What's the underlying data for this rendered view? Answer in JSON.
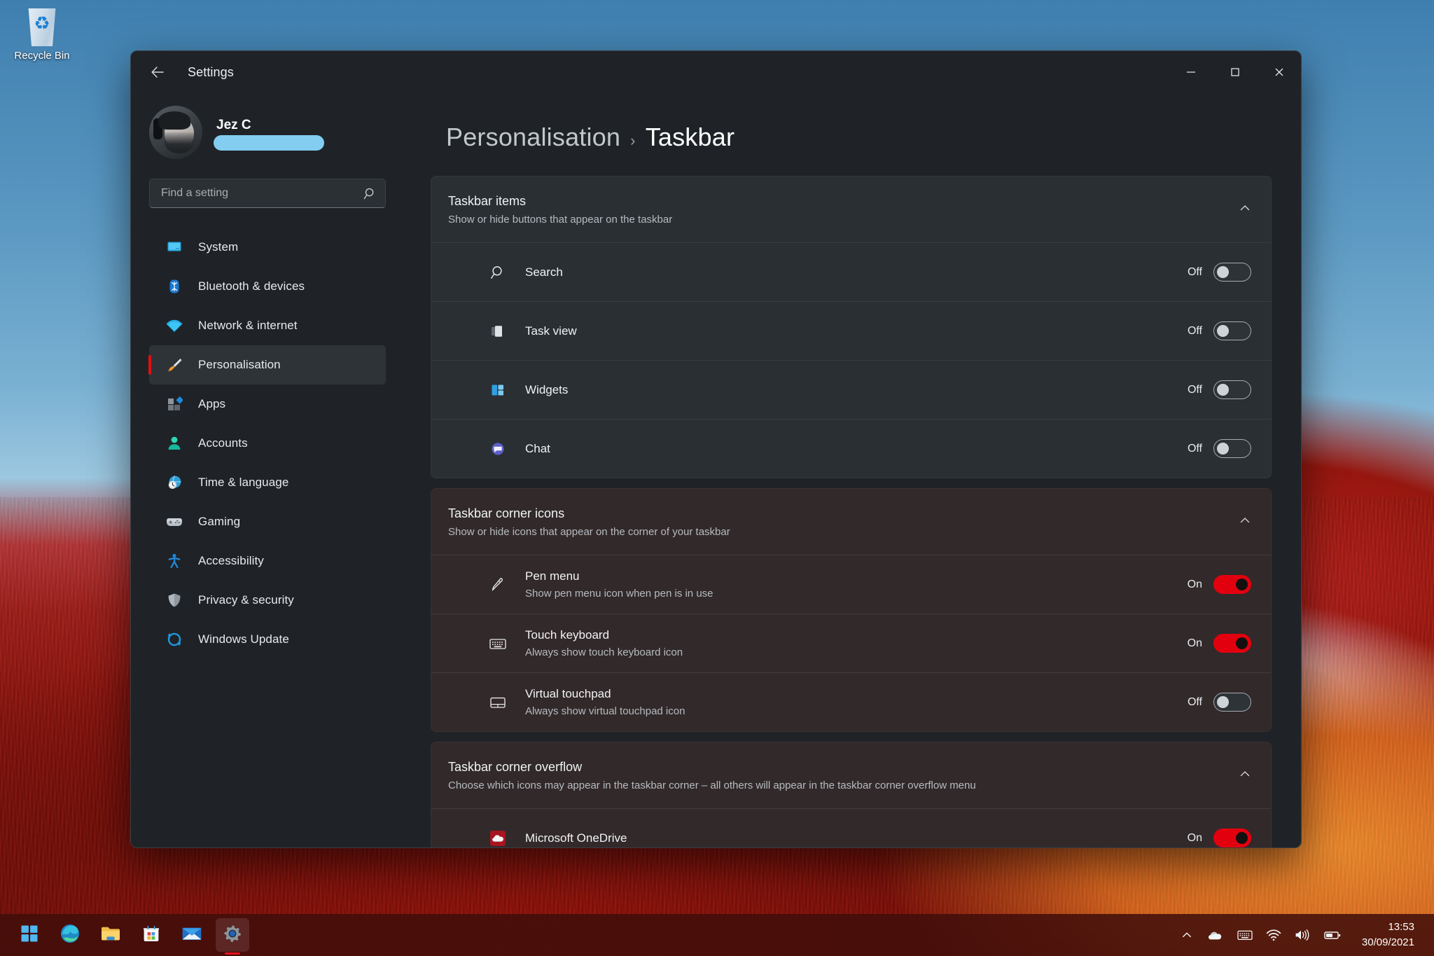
{
  "desktop": {
    "recycle_bin_label": "Recycle Bin",
    "recycle_bin_icon": "recycle-bin-icon"
  },
  "window": {
    "title": "Settings",
    "back_icon": "back-arrow-icon",
    "controls": {
      "minimize": "minimize-icon",
      "maximize": "maximize-icon",
      "close": "close-icon"
    }
  },
  "sidebar": {
    "account": {
      "name": "Jez C",
      "email": "redacted",
      "avatar_icon": "user-avatar"
    },
    "search": {
      "placeholder": "Find a setting",
      "value": "",
      "icon": "search-icon"
    },
    "items": [
      {
        "label": "System",
        "icon": "monitor-icon",
        "selected": false
      },
      {
        "label": "Bluetooth & devices",
        "icon": "bluetooth-icon",
        "selected": false
      },
      {
        "label": "Network & internet",
        "icon": "wifi-icon",
        "selected": false
      },
      {
        "label": "Personalisation",
        "icon": "paintbrush-icon",
        "selected": true
      },
      {
        "label": "Apps",
        "icon": "apps-grid-icon",
        "selected": false
      },
      {
        "label": "Accounts",
        "icon": "person-icon",
        "selected": false
      },
      {
        "label": "Time & language",
        "icon": "clock-globe-icon",
        "selected": false
      },
      {
        "label": "Gaming",
        "icon": "gamepad-icon",
        "selected": false
      },
      {
        "label": "Accessibility",
        "icon": "accessibility-icon",
        "selected": false
      },
      {
        "label": "Privacy & security",
        "icon": "shield-icon",
        "selected": false
      },
      {
        "label": "Windows Update",
        "icon": "update-refresh-icon",
        "selected": false
      }
    ]
  },
  "main": {
    "breadcrumb": {
      "parent": "Personalisation",
      "separator": "›",
      "current": "Taskbar"
    },
    "cards": [
      {
        "title": "Taskbar items",
        "subtitle": "Show or hide buttons that appear on the taskbar",
        "collapse_icon": "chevron-up-icon",
        "tinted": false,
        "rows": [
          {
            "label": "Search",
            "sub": "",
            "icon": "search-icon",
            "state": "Off",
            "on": false
          },
          {
            "label": "Task view",
            "sub": "",
            "icon": "task-view-icon",
            "state": "Off",
            "on": false
          },
          {
            "label": "Widgets",
            "sub": "",
            "icon": "widgets-icon",
            "state": "Off",
            "on": false
          },
          {
            "label": "Chat",
            "sub": "",
            "icon": "chat-teams-icon",
            "state": "Off",
            "on": false
          }
        ]
      },
      {
        "title": "Taskbar corner icons",
        "subtitle": "Show or hide icons that appear on the corner of your taskbar",
        "collapse_icon": "chevron-up-icon",
        "tinted": true,
        "rows": [
          {
            "label": "Pen menu",
            "sub": "Show pen menu icon when pen is in use",
            "icon": "pen-icon",
            "state": "On",
            "on": true
          },
          {
            "label": "Touch keyboard",
            "sub": "Always show touch keyboard icon",
            "icon": "keyboard-icon",
            "state": "On",
            "on": true
          },
          {
            "label": "Virtual touchpad",
            "sub": "Always show virtual touchpad icon",
            "icon": "touchpad-icon",
            "state": "Off",
            "on": false
          }
        ]
      },
      {
        "title": "Taskbar corner overflow",
        "subtitle": "Choose which icons may appear in the taskbar corner – all others will appear in the taskbar corner overflow menu",
        "collapse_icon": "chevron-up-icon",
        "tinted": true,
        "rows": [
          {
            "label": "Microsoft OneDrive",
            "sub": "",
            "icon": "onedrive-icon",
            "state": "On",
            "on": true
          }
        ]
      }
    ]
  },
  "taskbar": {
    "pinned": [
      {
        "name": "start-button",
        "icon": "windows-logo-icon",
        "active": false
      },
      {
        "name": "edge-button",
        "icon": "edge-icon",
        "active": false
      },
      {
        "name": "file-explorer-button",
        "icon": "folder-icon",
        "active": false
      },
      {
        "name": "microsoft-store-button",
        "icon": "store-icon",
        "active": false
      },
      {
        "name": "mail-button",
        "icon": "mail-icon",
        "active": false
      },
      {
        "name": "settings-button",
        "icon": "gear-icon",
        "active": true
      }
    ],
    "tray": [
      {
        "name": "show-hidden-icons",
        "icon": "chevron-up-icon"
      },
      {
        "name": "onedrive-tray",
        "icon": "cloud-icon"
      },
      {
        "name": "touch-keyboard-tray",
        "icon": "keyboard-icon"
      },
      {
        "name": "network-tray",
        "icon": "wifi-icon"
      },
      {
        "name": "volume-tray",
        "icon": "speaker-icon"
      },
      {
        "name": "battery-tray",
        "icon": "battery-icon"
      }
    ],
    "clock": {
      "time": "13:53",
      "date": "30/09/2021"
    }
  },
  "colors": {
    "accent_red": "#e2000f",
    "window_bg": "#1f2327",
    "card_bg": "#2a2f33",
    "card_bg_tinted": "#32292a",
    "redaction_blue": "#82cdf0"
  }
}
